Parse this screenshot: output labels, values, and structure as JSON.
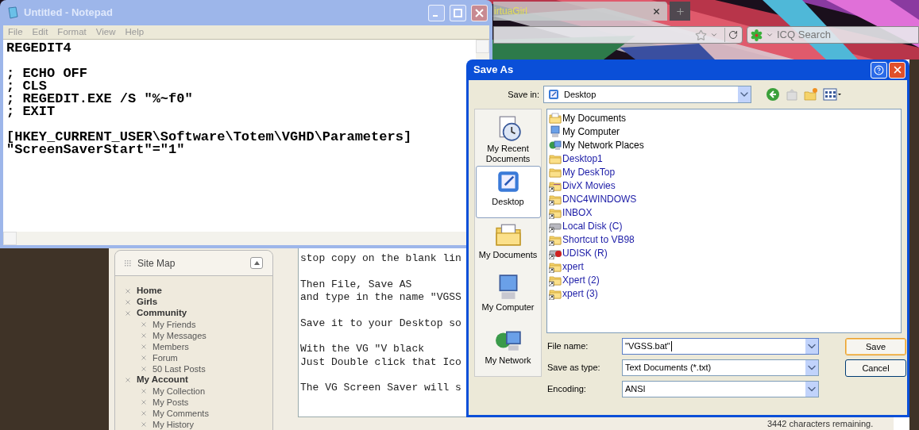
{
  "browser": {
    "tab": {
      "title": "irtuaGirl"
    },
    "search": {
      "placeholder": "ICQ Search"
    },
    "site_map": {
      "title": "Site Map",
      "items": [
        {
          "label": "Home"
        },
        {
          "label": "Girls"
        },
        {
          "label": "Community",
          "children": [
            {
              "label": "My Friends"
            },
            {
              "label": "My Messages"
            },
            {
              "label": "Members"
            },
            {
              "label": "Forum"
            },
            {
              "label": "50 Last Posts"
            }
          ]
        },
        {
          "label": "My Account",
          "children": [
            {
              "label": "My Collection"
            },
            {
              "label": "My Posts"
            },
            {
              "label": "My Comments"
            },
            {
              "label": "My History"
            }
          ]
        }
      ]
    },
    "editor": {
      "paragraphs": [
        [
          "stop copy on the blank lin"
        ],
        [
          "Then File, Save AS",
          "and type in the name \"VGSS"
        ],
        [
          "Save it to your Desktop so"
        ],
        [
          "With the VG \"V black",
          "Just Double click that Ico"
        ],
        [
          "The VG Screen Saver will s"
        ]
      ]
    },
    "counter": "3442 characters remaining."
  },
  "notepad": {
    "title": "Untitled - Notepad",
    "menu": [
      "File",
      "Edit",
      "Format",
      "View",
      "Help"
    ],
    "paragraphs": [
      [
        "REGEDIT4"
      ],
      [
        "; ECHO OFF",
        "; CLS",
        "; REGEDIT.EXE /S \"%~f0\"",
        "; EXIT"
      ],
      [
        "[HKEY_CURRENT_USER\\Software\\Totem\\VGHD\\Parameters]",
        "\"ScreenSaverStart\"=\"1\""
      ]
    ]
  },
  "save_as": {
    "title": "Save As",
    "save_in_label": "Save in:",
    "save_in": "Desktop",
    "places": [
      {
        "label": "My Recent Documents",
        "kind": "recent",
        "selected": false
      },
      {
        "label": "Desktop",
        "kind": "desktop",
        "selected": true
      },
      {
        "label": "My Documents",
        "kind": "documents",
        "selected": false
      },
      {
        "label": "My Computer",
        "kind": "computer",
        "selected": false
      },
      {
        "label": "My Network",
        "kind": "network",
        "selected": false
      }
    ],
    "files": [
      {
        "name": "My Documents",
        "kind": "documents",
        "color": "#000000"
      },
      {
        "name": "My Computer",
        "kind": "computer",
        "color": "#000000"
      },
      {
        "name": "My Network Places",
        "kind": "network",
        "color": "#000000"
      },
      {
        "name": "Desktop1",
        "kind": "folder",
        "color": "#1a1aa6"
      },
      {
        "name": "My DeskTop",
        "kind": "folder",
        "color": "#1a1aa6"
      },
      {
        "name": "DivX Movies",
        "kind": "shortcut-media",
        "color": "#1a1aa6"
      },
      {
        "name": "DNC4WINDOWS",
        "kind": "shortcut-folder",
        "color": "#1a1aa6"
      },
      {
        "name": "INBOX",
        "kind": "shortcut-folder",
        "color": "#1a1aa6"
      },
      {
        "name": "Local Disk (C)",
        "kind": "shortcut-drive",
        "color": "#1a1aa6"
      },
      {
        "name": "Shortcut to VB98",
        "kind": "shortcut-folder",
        "color": "#1a1aa6"
      },
      {
        "name": "UDISK (R)",
        "kind": "shortcut-unknown",
        "color": "#1a1aa6"
      },
      {
        "name": "xpert",
        "kind": "shortcut-folder",
        "color": "#1a1aa6"
      },
      {
        "name": "Xpert (2)",
        "kind": "shortcut-folder",
        "color": "#1a1aa6"
      },
      {
        "name": "xpert (3)",
        "kind": "shortcut-folder",
        "color": "#1a1aa6"
      }
    ],
    "fields": [
      {
        "label": "File name:",
        "value": "\"VGSS.bat\"",
        "focused": true
      },
      {
        "label": "Save as type:",
        "value": "Text Documents (*.txt)",
        "focused": false
      },
      {
        "label": "Encoding:",
        "value": "ANSI",
        "focused": false
      }
    ],
    "buttons": [
      {
        "label": "Save",
        "default": true
      },
      {
        "label": "Cancel",
        "default": false
      }
    ]
  }
}
